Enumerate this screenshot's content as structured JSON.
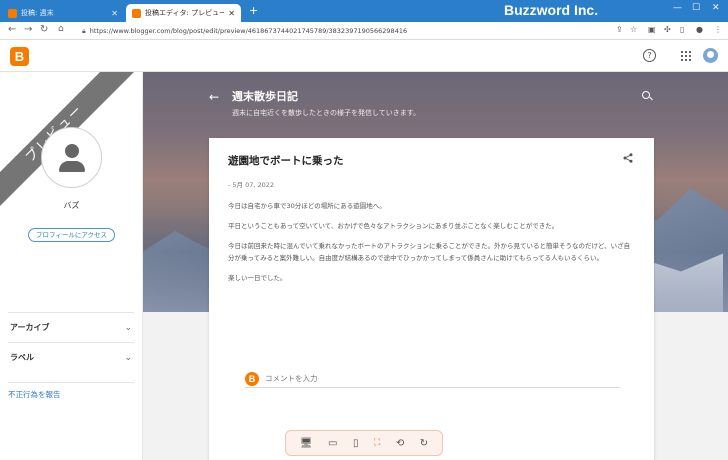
{
  "browser": {
    "tabs": [
      {
        "title": "投稿: 週末",
        "active": false
      },
      {
        "title": "投稿エディタ: プレビュー",
        "active": true
      }
    ],
    "brand": "Buzzword Inc.",
    "url": "https://www.blogger.com/blog/post/edit/preview/4618673744021745789/3832397190566298416"
  },
  "colors": {
    "tab_bar": "#2b7ec9",
    "blogger_orange": "#f57c00",
    "link_blue": "#2f7bc4",
    "ribbon": "#757575"
  },
  "sidebar": {
    "ribbon_text": "プレビュー",
    "profile_name": "バズ",
    "profile_button": "プロフィールにアクセス",
    "sections": [
      {
        "label": "アーカイブ"
      },
      {
        "label": "ラベル"
      }
    ],
    "report_link": "不正行為を報告"
  },
  "blog": {
    "title": "週末散歩日記",
    "description": "週末に自宅近くを散歩したときの様子を発信していきます。"
  },
  "post": {
    "title": "遊園地でボートに乗った",
    "date": "- 5月 07, 2022",
    "paragraphs": [
      "今日は自宅から車で30分ほどの場所にある遊園地へ。",
      "平日ということもあって空いていて、おかげで色々なアトラクションにあまり並ぶことなく楽しむことができた。",
      "今日は前回来た時に混んでいて乗れなかったボートのアトラクションに乗ることができた。外から見ていると簡単そうなのだけど、いざ自分が乗ってみると案外難しい。自由度が結構あるので途中でひっかかってしまって係員さんに助けてもらってる人もいるくらい。",
      "楽しい一日でした。"
    ],
    "comment_placeholder": "コメントを入力"
  }
}
